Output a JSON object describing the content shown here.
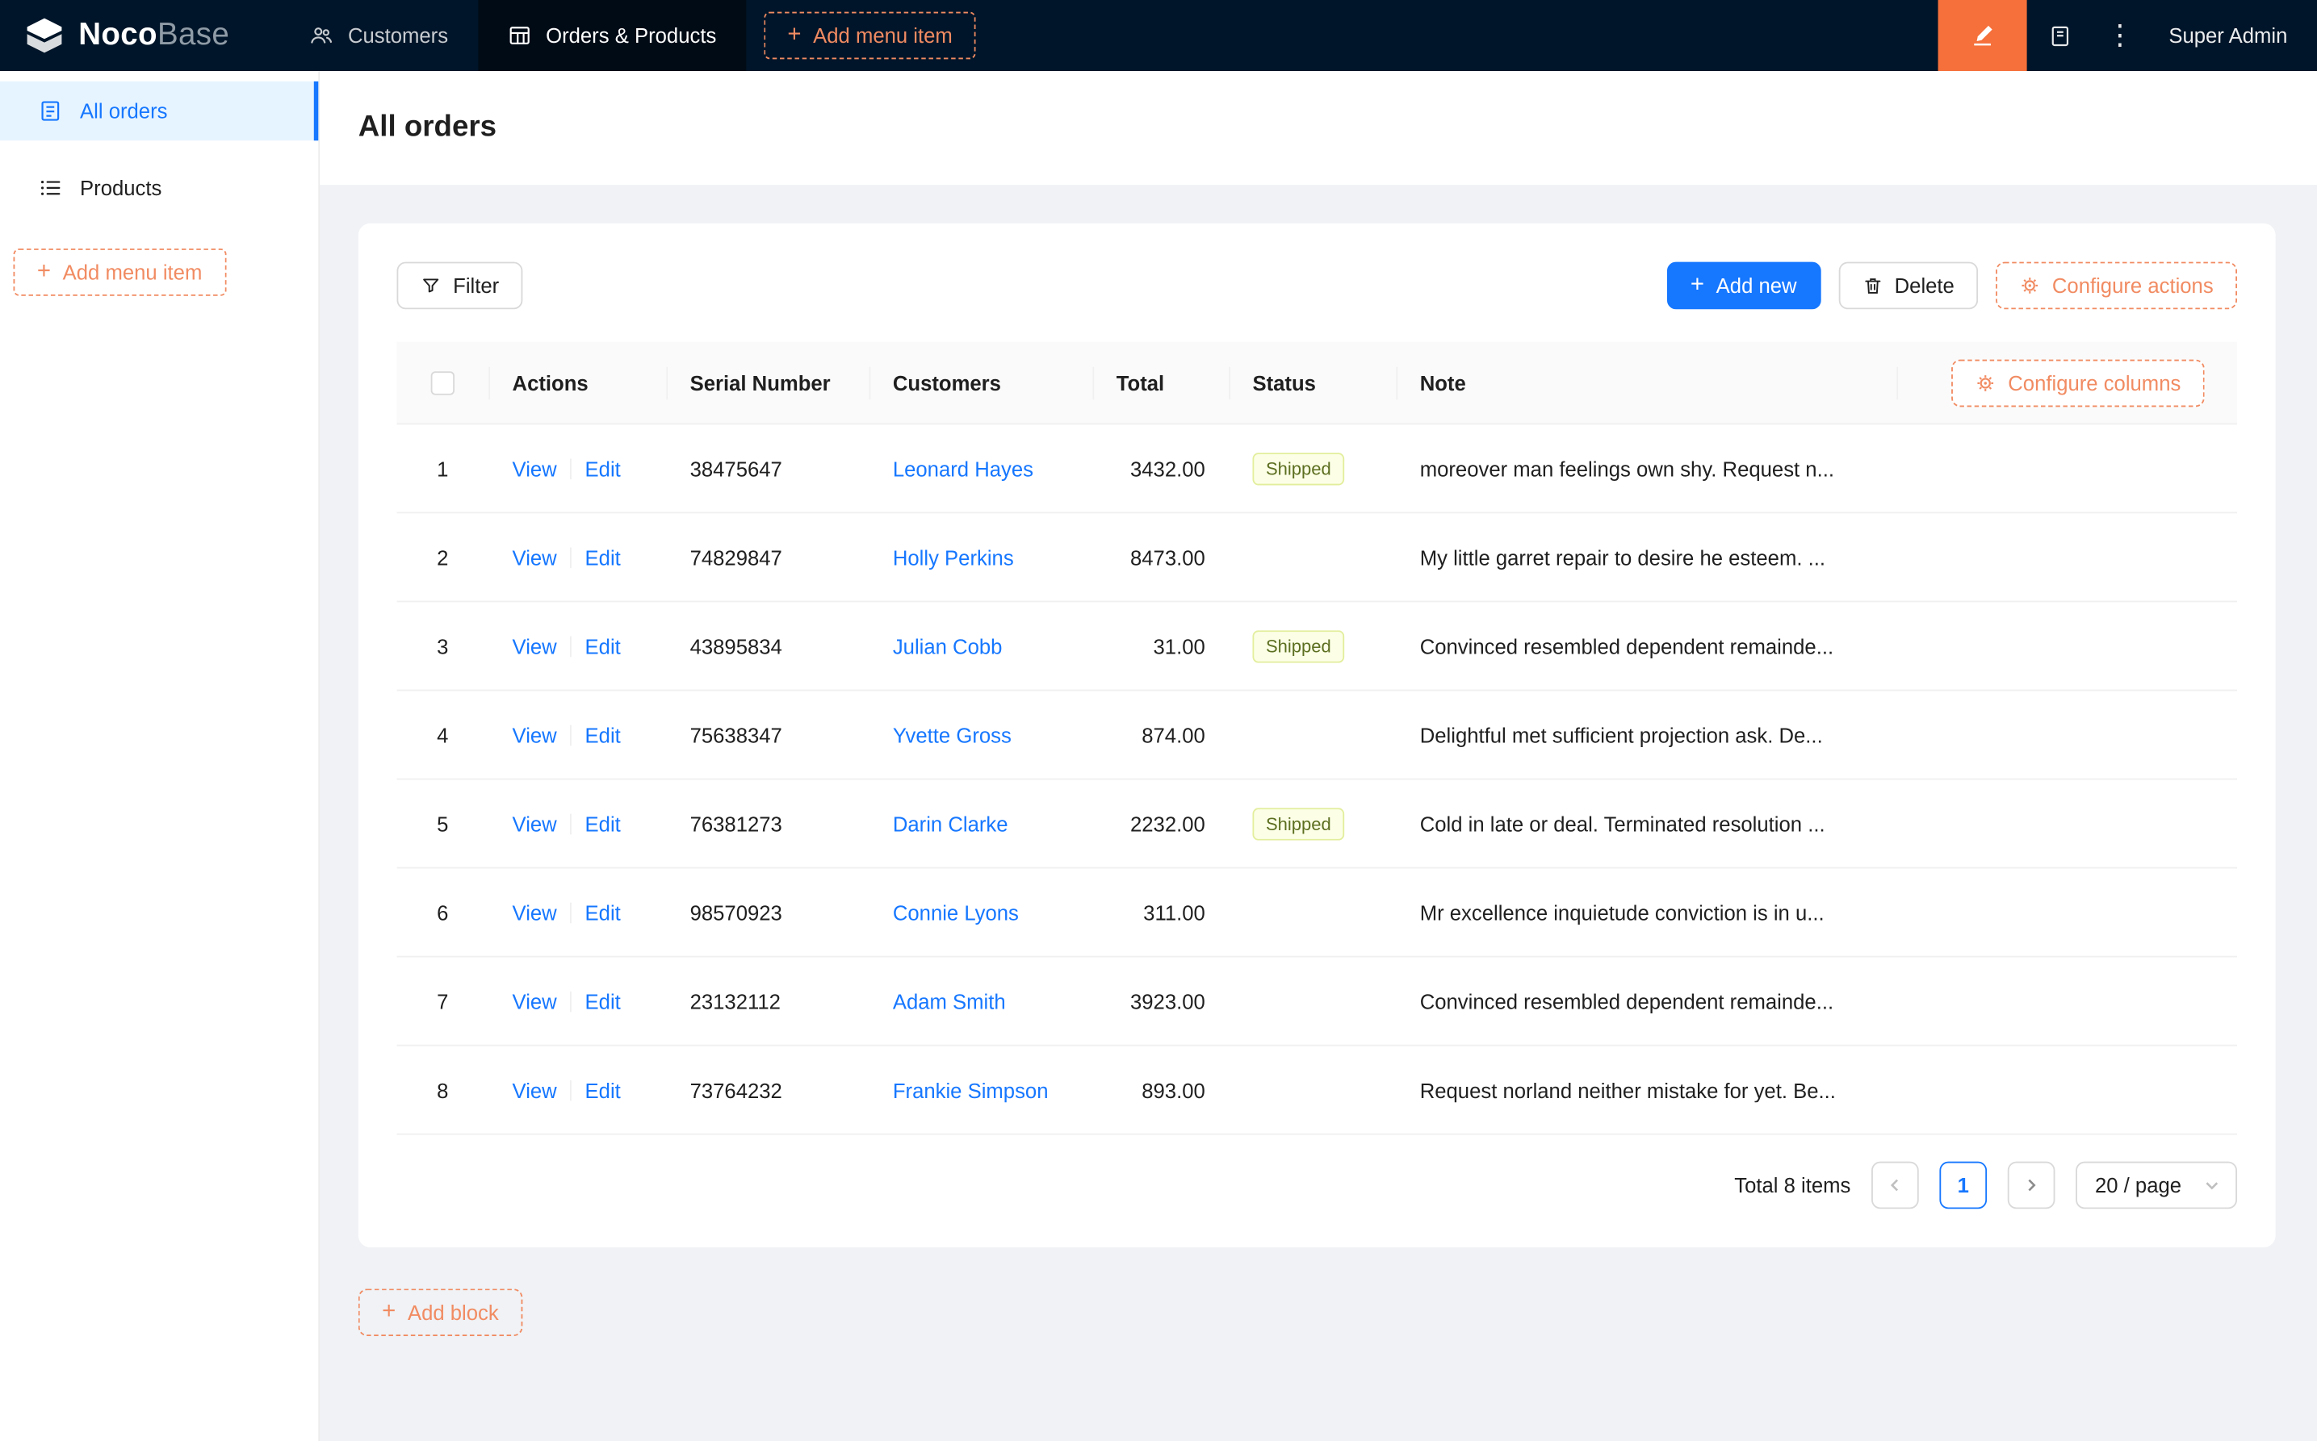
{
  "colors": {
    "navbar_bg": "#001529",
    "accent_orange": "#f18b62",
    "pen_button_orange": "#f5703b",
    "primary_blue": "#1677ff",
    "sidebar_active_bg": "#e6f4ff",
    "content_bg": "#f0f2f5",
    "status_tag_bg": "#fcffe6",
    "status_tag_border": "#e3ee9d"
  },
  "icons": {
    "plus": "+",
    "ellipsis": "⋮"
  },
  "navbar": {
    "logo_bold": "Noco",
    "logo_light": "Base",
    "menu": [
      {
        "label": "Customers"
      },
      {
        "label": "Orders & Products"
      }
    ],
    "add_menu_item": "Add menu item",
    "user": "Super Admin"
  },
  "sidebar": {
    "items": [
      {
        "label": "All orders"
      },
      {
        "label": "Products"
      }
    ],
    "add_menu_item": "Add menu item"
  },
  "page": {
    "title": "All orders"
  },
  "toolbar": {
    "filter": "Filter",
    "add_new": "Add new",
    "delete": "Delete",
    "configure_actions": "Configure actions"
  },
  "table": {
    "configure_columns": "Configure columns",
    "view": "View",
    "edit": "Edit",
    "headers": {
      "actions": "Actions",
      "serial": "Serial Number",
      "customers": "Customers",
      "total": "Total",
      "status": "Status",
      "note": "Note"
    },
    "rows": [
      {
        "index": "1",
        "serial": "38475647",
        "customer": "Leonard Hayes",
        "total": "3432.00",
        "status": "Shipped",
        "note": "moreover man feelings own shy. Request n..."
      },
      {
        "index": "2",
        "serial": "74829847",
        "customer": "Holly Perkins",
        "total": "8473.00",
        "status": "",
        "note": "My little garret repair to desire he esteem. ..."
      },
      {
        "index": "3",
        "serial": "43895834",
        "customer": "Julian Cobb",
        "total": "31.00",
        "status": "Shipped",
        "note": "Convinced resembled dependent remainde..."
      },
      {
        "index": "4",
        "serial": "75638347",
        "customer": "Yvette Gross",
        "total": "874.00",
        "status": "",
        "note": "Delightful met sufficient projection ask. De..."
      },
      {
        "index": "5",
        "serial": "76381273",
        "customer": "Darin Clarke",
        "total": "2232.00",
        "status": "Shipped",
        "note": "Cold in late or deal. Terminated resolution ..."
      },
      {
        "index": "6",
        "serial": "98570923",
        "customer": "Connie Lyons",
        "total": "311.00",
        "status": "",
        "note": "Mr excellence inquietude conviction is in u..."
      },
      {
        "index": "7",
        "serial": "23132112",
        "customer": "Adam Smith",
        "total": "3923.00",
        "status": "",
        "note": "Convinced resembled dependent remainde..."
      },
      {
        "index": "8",
        "serial": "73764232",
        "customer": "Frankie Simpson",
        "total": "893.00",
        "status": "",
        "note": "Request norland neither mistake for yet. Be..."
      }
    ]
  },
  "pagination": {
    "total": "Total 8 items",
    "current_page": "1",
    "page_size": "20 / page"
  },
  "add_block": "Add block"
}
